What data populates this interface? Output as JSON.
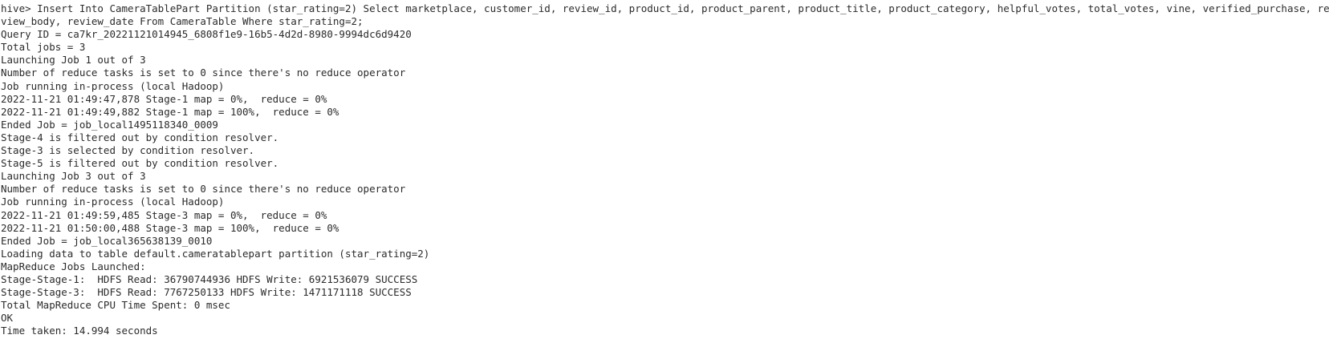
{
  "terminal": {
    "lines": [
      "hive> Insert Into CameraTablePart Partition (star_rating=2) Select marketplace, customer_id, review_id, product_id, product_parent, product_title, product_category, helpful_votes, total_votes, vine, verified_purchase, review_headline, re",
      "view_body, review_date From CameraTable Where star_rating=2;",
      "Query ID = ca7kr_20221121014945_6808f1e9-16b5-4d2d-8980-9994dc6d9420",
      "Total jobs = 3",
      "Launching Job 1 out of 3",
      "Number of reduce tasks is set to 0 since there's no reduce operator",
      "Job running in-process (local Hadoop)",
      "2022-11-21 01:49:47,878 Stage-1 map = 0%,  reduce = 0%",
      "2022-11-21 01:49:49,882 Stage-1 map = 100%,  reduce = 0%",
      "Ended Job = job_local1495118340_0009",
      "Stage-4 is filtered out by condition resolver.",
      "Stage-3 is selected by condition resolver.",
      "Stage-5 is filtered out by condition resolver.",
      "Launching Job 3 out of 3",
      "Number of reduce tasks is set to 0 since there's no reduce operator",
      "Job running in-process (local Hadoop)",
      "2022-11-21 01:49:59,485 Stage-3 map = 0%,  reduce = 0%",
      "2022-11-21 01:50:00,488 Stage-3 map = 100%,  reduce = 0%",
      "Ended Job = job_local365638139_0010",
      "Loading data to table default.cameratablepart partition (star_rating=2)",
      "MapReduce Jobs Launched:",
      "Stage-Stage-1:  HDFS Read: 36790744936 HDFS Write: 6921536079 SUCCESS",
      "Stage-Stage-3:  HDFS Read: 7767250133 HDFS Write: 1471171118 SUCCESS",
      "Total MapReduce CPU Time Spent: 0 msec",
      "OK",
      "Time taken: 14.994 seconds"
    ]
  }
}
